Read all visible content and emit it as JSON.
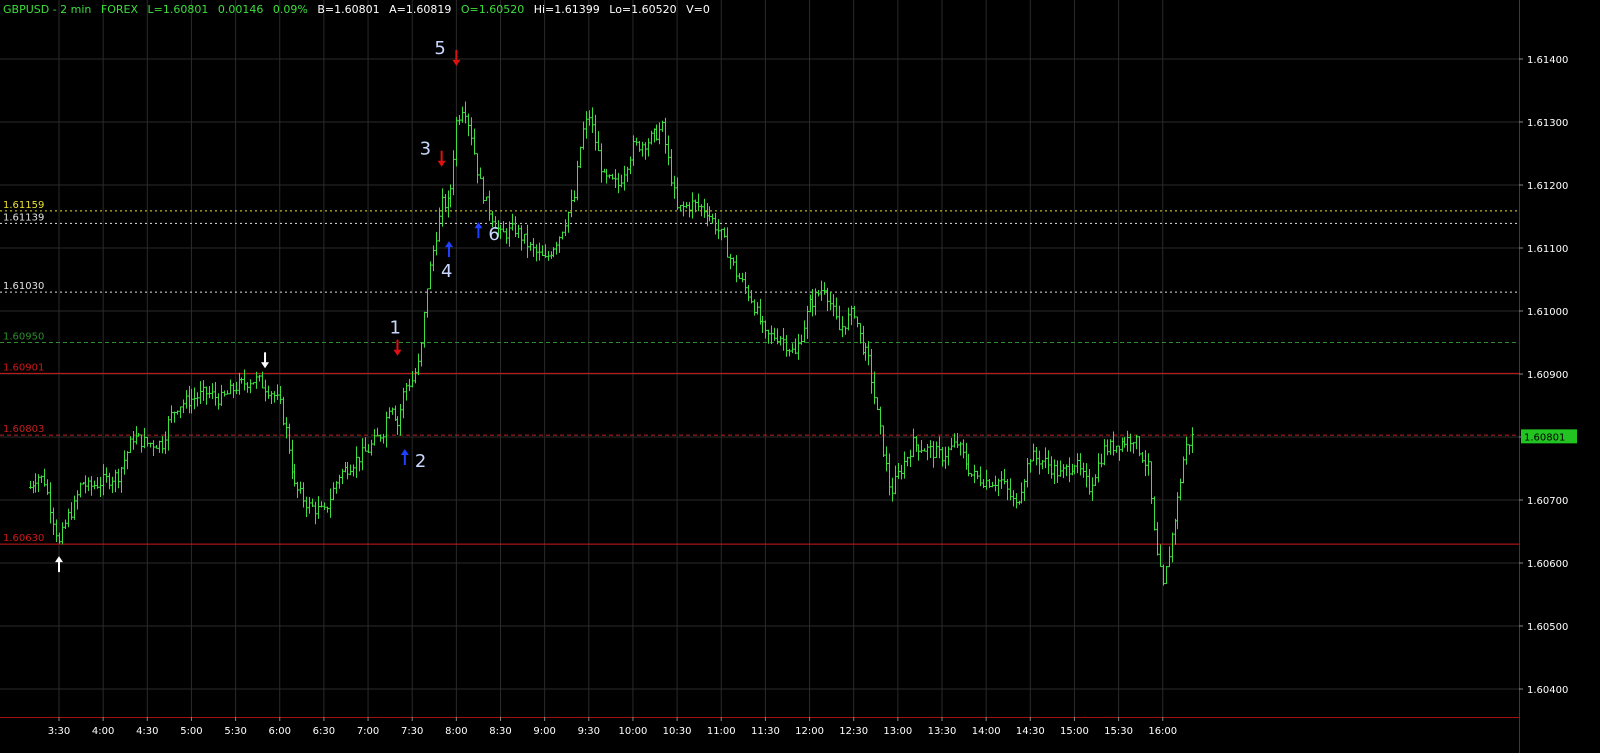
{
  "header": {
    "symbol": "GBPUSD - 2 min",
    "market": "FOREX",
    "last": "L=1.60801",
    "change": "0.00146",
    "pct": "0.09%",
    "bid": "B=1.60801",
    "ask": "A=1.60819",
    "open": "O=1.60520",
    "high": "Hi=1.61399",
    "low": "Lo=1.60520",
    "volume": "V=0"
  },
  "colors": {
    "background": "#000000",
    "bars": "#3dde3d",
    "grid": "#2a2a2a",
    "axis_frame": "#a01010",
    "support_line": "#d01818",
    "resistance_dash": "#c02020",
    "yellow_level": "#e8e030",
    "white_level": "#e0e0e0",
    "green_level": "#2e8b2e",
    "sell_arrow": "#e01010",
    "buy_arrow": "#2040ff",
    "white_arrow": "#ffffff",
    "label_text": "#c8d8ff"
  },
  "chart_data": {
    "type": "bar",
    "title": "",
    "ylim": [
      1.6034,
      1.6146
    ],
    "y_ticks": [
      "1.61400",
      "1.61300",
      "1.61200",
      "1.61100",
      "1.61000",
      "1.60900",
      "1.60800",
      "1.60700",
      "1.60600",
      "1.60500",
      "1.60400"
    ],
    "x_ticks": [
      "3:30",
      "4:00",
      "4:30",
      "5:00",
      "5:30",
      "6:00",
      "6:30",
      "7:00",
      "7:30",
      "8:00",
      "8:30",
      "9:00",
      "9:30",
      "10:00",
      "10:30",
      "11:00",
      "11:30",
      "12:00",
      "12:30",
      "13:00",
      "13:30",
      "14:00",
      "14:30",
      "15:00",
      "15:30",
      "16:00"
    ],
    "last_price_tag": "1.60801",
    "levels": [
      {
        "value": 1.61159,
        "label": "1.61159",
        "style": "dotted",
        "color": "yellow"
      },
      {
        "value": 1.61139,
        "label": "1.61139",
        "style": "dotted",
        "color": "white"
      },
      {
        "value": 1.6103,
        "label": "1.61030",
        "style": "dotted",
        "color": "white"
      },
      {
        "value": 1.6095,
        "label": "1.60950",
        "style": "dashed",
        "color": "green"
      },
      {
        "value": 1.60901,
        "label": "1.60901",
        "style": "solid",
        "color": "red"
      },
      {
        "value": 1.60803,
        "label": "1.60803",
        "style": "dashed",
        "color": "red"
      },
      {
        "value": 1.6063,
        "label": "1.60630",
        "style": "solid",
        "color": "red"
      }
    ],
    "price_path": [
      [
        "3:10",
        1.6072
      ],
      [
        "3:15",
        1.6074
      ],
      [
        "3:20",
        1.6073
      ],
      [
        "3:25",
        1.6068
      ],
      [
        "3:30",
        1.6063
      ],
      [
        "3:35",
        1.6067
      ],
      [
        "3:40",
        1.6069
      ],
      [
        "3:45",
        1.6073
      ],
      [
        "3:50",
        1.6072
      ],
      [
        "4:00",
        1.6073
      ],
      [
        "4:10",
        1.6074
      ],
      [
        "4:15",
        1.6077
      ],
      [
        "4:20",
        1.608
      ],
      [
        "4:30",
        1.6079
      ],
      [
        "4:40",
        1.6079
      ],
      [
        "4:45",
        1.6083
      ],
      [
        "4:50",
        1.6085
      ],
      [
        "5:00",
        1.6086
      ],
      [
        "5:10",
        1.6087
      ],
      [
        "5:20",
        1.6086
      ],
      [
        "5:30",
        1.6088
      ],
      [
        "5:40",
        1.6089
      ],
      [
        "5:45",
        1.6089
      ],
      [
        "5:55",
        1.6087
      ],
      [
        "6:00",
        1.6085
      ],
      [
        "6:05",
        1.608
      ],
      [
        "6:10",
        1.6072
      ],
      [
        "6:20",
        1.6069
      ],
      [
        "6:30",
        1.6068
      ],
      [
        "6:40",
        1.6074
      ],
      [
        "6:50",
        1.6076
      ],
      [
        "7:00",
        1.6078
      ],
      [
        "7:10",
        1.6081
      ],
      [
        "7:15",
        1.6086
      ],
      [
        "7:20",
        1.6082
      ],
      [
        "7:25",
        1.6088
      ],
      [
        "7:30",
        1.6089
      ],
      [
        "7:35",
        1.6092
      ],
      [
        "7:40",
        1.6104
      ],
      [
        "7:45",
        1.6111
      ],
      [
        "7:50",
        1.6117
      ],
      [
        "7:55",
        1.6117
      ],
      [
        "8:00",
        1.613
      ],
      [
        "8:05",
        1.6133
      ],
      [
        "8:10",
        1.6128
      ],
      [
        "8:15",
        1.6121
      ],
      [
        "8:20",
        1.6117
      ],
      [
        "8:30",
        1.6112
      ],
      [
        "8:40",
        1.6113
      ],
      [
        "8:50",
        1.611
      ],
      [
        "9:00",
        1.6108
      ],
      [
        "9:10",
        1.6112
      ],
      [
        "9:20",
        1.6118
      ],
      [
        "9:25",
        1.6128
      ],
      [
        "9:30",
        1.6131
      ],
      [
        "9:40",
        1.6121
      ],
      [
        "9:50",
        1.612
      ],
      [
        "10:00",
        1.6126
      ],
      [
        "10:10",
        1.6127
      ],
      [
        "10:20",
        1.6129
      ],
      [
        "10:30",
        1.6116
      ],
      [
        "10:40",
        1.6117
      ],
      [
        "10:50",
        1.6116
      ],
      [
        "11:00",
        1.6112
      ],
      [
        "11:10",
        1.6106
      ],
      [
        "11:20",
        1.6102
      ],
      [
        "11:30",
        1.6096
      ],
      [
        "11:40",
        1.6096
      ],
      [
        "11:50",
        1.6093
      ],
      [
        "12:00",
        1.6101
      ],
      [
        "12:10",
        1.6104
      ],
      [
        "12:20",
        1.6097
      ],
      [
        "12:30",
        1.61
      ],
      [
        "12:35",
        1.6095
      ],
      [
        "12:40",
        1.6092
      ],
      [
        "12:45",
        1.6085
      ],
      [
        "12:50",
        1.6078
      ],
      [
        "12:55",
        1.6071
      ],
      [
        "13:00",
        1.6074
      ],
      [
        "13:10",
        1.6079
      ],
      [
        "13:20",
        1.6078
      ],
      [
        "13:30",
        1.6077
      ],
      [
        "13:40",
        1.6079
      ],
      [
        "13:50",
        1.6074
      ],
      [
        "14:00",
        1.6073
      ],
      [
        "14:10",
        1.6073
      ],
      [
        "14:20",
        1.6069
      ],
      [
        "14:30",
        1.6077
      ],
      [
        "14:40",
        1.6076
      ],
      [
        "14:50",
        1.6074
      ],
      [
        "15:00",
        1.6076
      ],
      [
        "15:10",
        1.6072
      ],
      [
        "15:20",
        1.6078
      ],
      [
        "15:30",
        1.6079
      ],
      [
        "15:40",
        1.608
      ],
      [
        "15:50",
        1.6075
      ],
      [
        "15:55",
        1.6062
      ],
      [
        "16:00",
        1.6056
      ],
      [
        "16:05",
        1.6063
      ],
      [
        "16:10",
        1.607
      ],
      [
        "16:15",
        1.6078
      ],
      [
        "16:20",
        1.608
      ]
    ],
    "annotations": [
      {
        "label": "",
        "time": "3:30",
        "value": 1.6063,
        "arrow": "up",
        "color": "white"
      },
      {
        "label": "",
        "time": "5:50",
        "value": 1.6089,
        "arrow": "down",
        "color": "white"
      },
      {
        "label": "1",
        "time": "7:20",
        "value": 1.6091,
        "arrow": "down",
        "color": "red"
      },
      {
        "label": "2",
        "time": "7:25",
        "value": 1.608,
        "arrow": "up",
        "color": "blue"
      },
      {
        "label": "3",
        "time": "7:50",
        "value": 1.6121,
        "arrow": "down",
        "color": "red"
      },
      {
        "label": "4",
        "time": "7:55",
        "value": 1.6113,
        "arrow": "up",
        "color": "blue"
      },
      {
        "label": "5",
        "time": "8:00",
        "value": 1.6137,
        "arrow": "down",
        "color": "red"
      },
      {
        "label": "6",
        "time": "8:15",
        "value": 1.6116,
        "arrow": "up",
        "color": "blue"
      }
    ]
  }
}
